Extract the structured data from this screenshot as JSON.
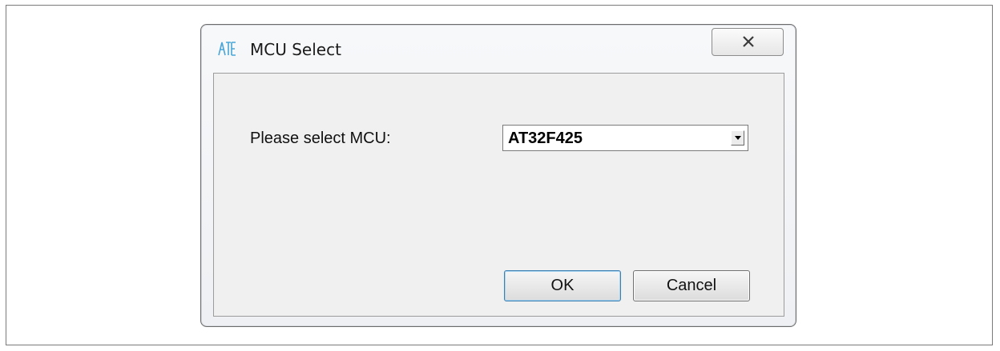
{
  "window": {
    "title": "MCU Select",
    "icon": "artery-app-icon",
    "close_icon": "close-icon"
  },
  "form": {
    "label": "Please select MCU:",
    "select_value": "AT32F425",
    "dropdown_icon": "chevron-down-icon"
  },
  "buttons": {
    "ok_label": "OK",
    "cancel_label": "Cancel"
  },
  "colors": {
    "default_button_border": "#3c7fb1",
    "client_background": "#f0f0f0"
  }
}
